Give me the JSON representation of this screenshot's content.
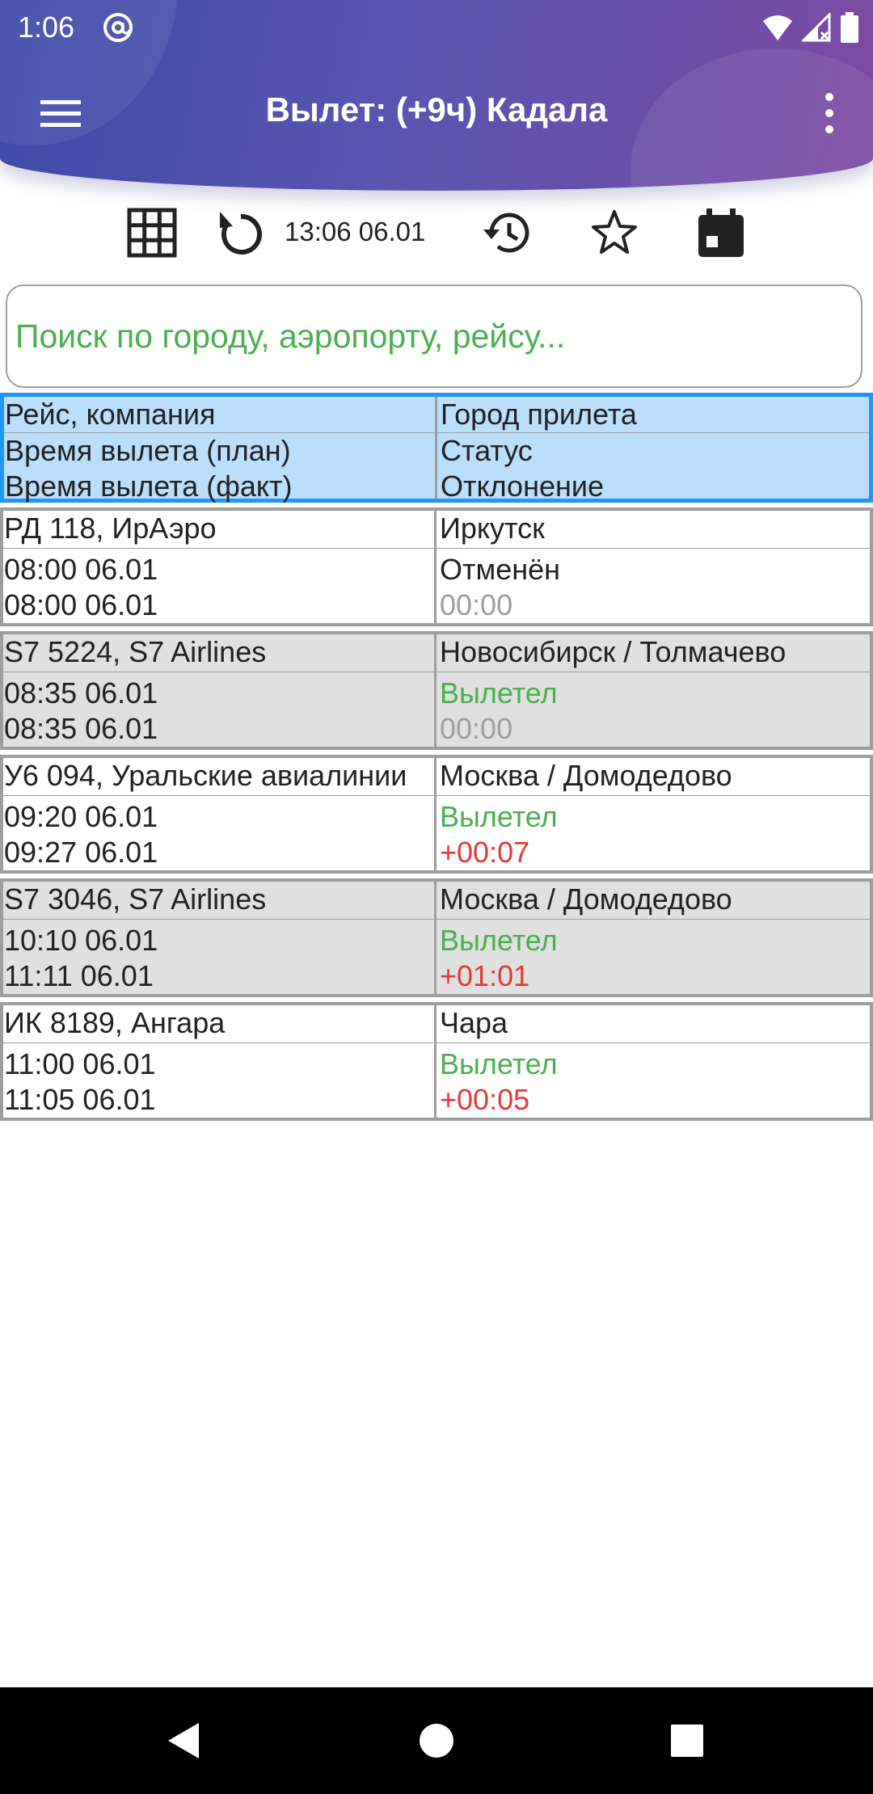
{
  "status_bar": {
    "time": "1:06",
    "icons": [
      "at-sign-icon",
      "wifi-icon",
      "signal-icon",
      "battery-icon"
    ]
  },
  "app_bar": {
    "title": "Вылет: (+9ч) Кадала",
    "menu_icon": "hamburger-menu-icon",
    "more_icon": "more-vert-icon"
  },
  "toolbar": {
    "updated_time": "13:06 06.01",
    "icons": [
      "grid-icon",
      "refresh-icon",
      "history-icon",
      "star-icon",
      "calendar-icon"
    ]
  },
  "search": {
    "placeholder": "Поиск по городу, аэропорту, рейсу...",
    "value": ""
  },
  "colors": {
    "header_start": "#3f4aa8",
    "header_end": "#7e4aa2",
    "header_row_bg": "#bbdefb",
    "header_row_border": "#2196f3",
    "status_ok": "#4caf50",
    "delay": "#e53935",
    "zero_delay": "#9e9e9e"
  },
  "table": {
    "header": {
      "left_top": "Рейс, компания",
      "left_bottom_1": "Время вылета (план)",
      "left_bottom_2": "Время вылета (факт)",
      "right_top": "Город прилета",
      "right_bottom_1": "Статус",
      "right_bottom_2": "Отклонение"
    },
    "rows": [
      {
        "flight": "РД 118, ИрАэро",
        "planned": "08:00 06.01",
        "actual": "08:00 06.01",
        "city": "Иркутск",
        "status": "Отменён",
        "deviation": "00:00",
        "status_color": "default",
        "deviation_color": "gray"
      },
      {
        "flight": "S7 5224, S7 Airlines",
        "planned": "08:35 06.01",
        "actual": "08:35 06.01",
        "city": "Новосибирск / Толмачево",
        "status": "Вылетел",
        "deviation": "00:00",
        "status_color": "green",
        "deviation_color": "gray"
      },
      {
        "flight": "У6 094, Уральские авиалинии",
        "planned": "09:20 06.01",
        "actual": "09:27 06.01",
        "city": "Москва / Домодедово",
        "status": "Вылетел",
        "deviation": "+00:07",
        "status_color": "green",
        "deviation_color": "red"
      },
      {
        "flight": "S7 3046, S7 Airlines",
        "planned": "10:10 06.01",
        "actual": "11:11 06.01",
        "city": "Москва / Домодедово",
        "status": "Вылетел",
        "deviation": "+01:01",
        "status_color": "green",
        "deviation_color": "red"
      },
      {
        "flight": "ИК 8189, Ангара",
        "planned": "11:00 06.01",
        "actual": "11:05 06.01",
        "city": "Чара",
        "status": "Вылетел",
        "deviation": "+00:05",
        "status_color": "green",
        "deviation_color": "red"
      }
    ]
  },
  "nav_bar": {
    "icons": [
      "back-icon",
      "home-icon",
      "recents-icon"
    ]
  }
}
